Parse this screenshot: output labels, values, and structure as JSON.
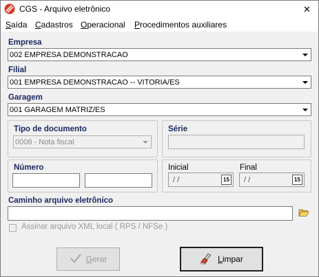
{
  "window": {
    "title": "CGS - Arquivo eletrônico",
    "close_glyph": "✕"
  },
  "menu": [
    {
      "label": "Saída",
      "key": "S",
      "rest": "aída"
    },
    {
      "label": "Cadastros",
      "key": "C",
      "rest": "adastros"
    },
    {
      "label": "Operacional",
      "key": "O",
      "rest": "peracional"
    },
    {
      "label": "Procedimentos auxiliares",
      "key": "P",
      "rest": "rocedimentos auxiliares"
    }
  ],
  "empresa": {
    "label": "Empresa",
    "value": "002 EMPRESA DEMONSTRACAO"
  },
  "filial": {
    "label": "Filial",
    "value": "001 EMPRESA DEMONSTRACAO -- VITORIA/ES"
  },
  "garagem": {
    "label": "Garagem",
    "value": "001 GARAGEM MATRIZ/ES"
  },
  "tipo_documento": {
    "label": "Tipo de documento",
    "value": "0008 - Nota fiscal"
  },
  "serie": {
    "label": "Série",
    "value": ""
  },
  "numero": {
    "label": "Número",
    "start": "",
    "end": ""
  },
  "inicial": {
    "label": "Inicial",
    "value": "/ /",
    "cal_glyph": "15"
  },
  "final": {
    "label": "Final",
    "value": "/ /",
    "cal_glyph": "15"
  },
  "caminho": {
    "label": "Caminho arquivo eletrônico",
    "value": ""
  },
  "assinar": {
    "label": "Assinar arquivo XML local ( RPS / NFSe )",
    "checked": false
  },
  "buttons": {
    "gerar": {
      "key": "G",
      "rest": "erar"
    },
    "limpar": {
      "key": "L",
      "rest": "impar"
    }
  },
  "colors": {
    "label_blue": "#1c2a60",
    "icon_red": "#d83b24"
  }
}
